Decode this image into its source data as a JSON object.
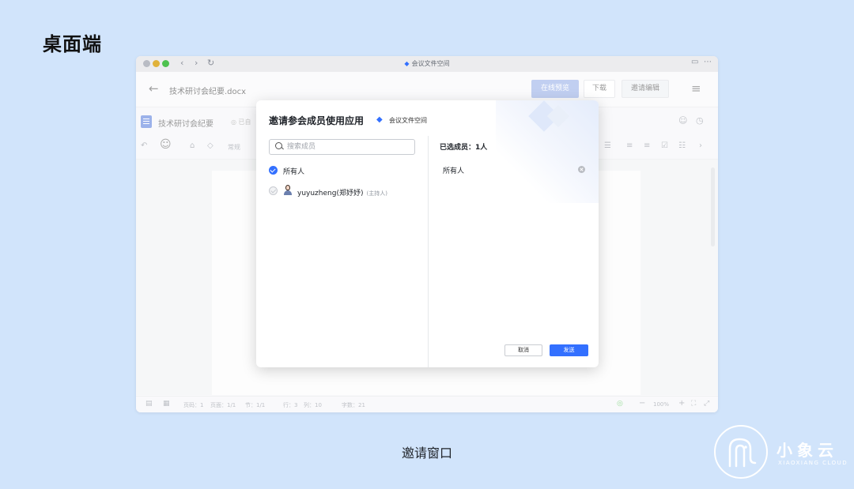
{
  "page": {
    "heading": "桌面端",
    "caption": "邀请窗口"
  },
  "window": {
    "title": "会议文件空间",
    "nav": {
      "back": "‹",
      "forward": "›",
      "refresh": "↻"
    },
    "header": {
      "back_icon": "arrow-left-icon",
      "file_name": "技术研讨会纪要.docx",
      "btn_preview": "在线预览",
      "btn_download": "下载",
      "btn_invite_edit": "邀请编辑",
      "menu_icon": "≡"
    },
    "doc": {
      "title": "技术研讨会纪要",
      "status": "◎ 已自",
      "toolbar_style": "常规"
    },
    "status_bar": {
      "page_code": "页码：1",
      "page_count": "页面：1/1",
      "section": "节：1/1",
      "line": "行：3",
      "column": "列：10",
      "words": "字数：21",
      "zoom": "100%"
    }
  },
  "dialog": {
    "title": "邀请参会成员使用应用",
    "space_name": "会议文件空间",
    "search_placeholder": "搜索成员",
    "members": [
      {
        "name": "所有人",
        "role": "",
        "checked": true
      },
      {
        "name": "yuyuzheng(郑妤妤)",
        "role": "(主持人)",
        "checked": true,
        "disabled": true
      }
    ],
    "selected_title": "已选成员：1人",
    "selected": [
      {
        "name": "所有人"
      }
    ],
    "btn_cancel": "取消",
    "btn_send": "发送"
  },
  "brand": {
    "name": "小象云",
    "sub": "XIAOXIANG CLOUD"
  },
  "colors": {
    "accent": "#3370ff",
    "page_bg": "#d1e4fb"
  }
}
